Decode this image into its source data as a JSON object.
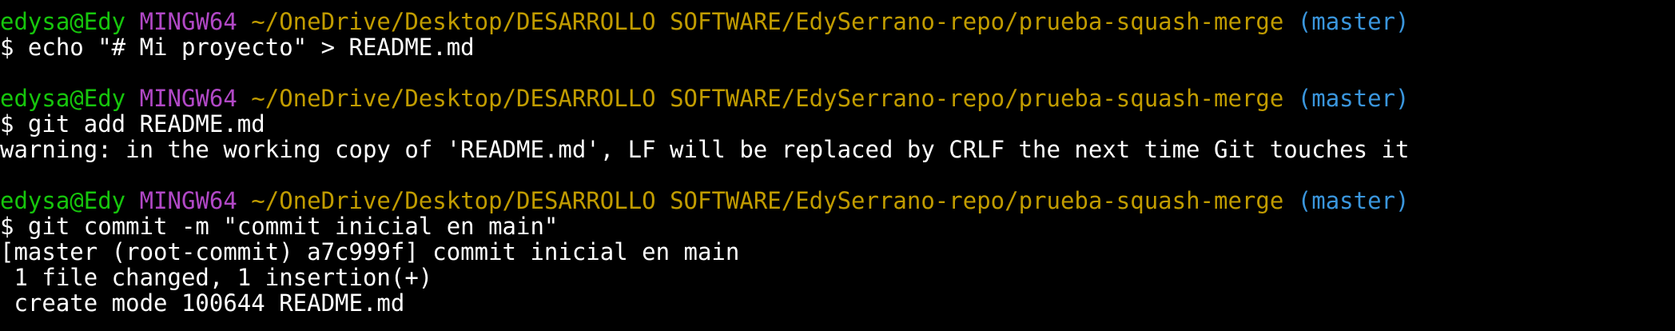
{
  "colors": {
    "background": "#000000",
    "user": "#16c60c",
    "env": "#b148c6",
    "path": "#c19c00",
    "branch": "#3a96dd",
    "text": "#ffffff"
  },
  "blocks": [
    {
      "prompt": {
        "user": "edysa@Edy",
        "env": "MINGW64",
        "path": "~/OneDrive/Desktop/DESARROLLO SOFTWARE/EdySerrano-repo/prueba-squash-merge",
        "branch": "(master)"
      },
      "command": "$ echo \"# Mi proyecto\" > README.md",
      "output": []
    },
    {
      "prompt": {
        "user": "edysa@Edy",
        "env": "MINGW64",
        "path": "~/OneDrive/Desktop/DESARROLLO SOFTWARE/EdySerrano-repo/prueba-squash-merge",
        "branch": "(master)"
      },
      "command": "$ git add README.md",
      "output": [
        "warning: in the working copy of 'README.md', LF will be replaced by CRLF the next time Git touches it"
      ]
    },
    {
      "prompt": {
        "user": "edysa@Edy",
        "env": "MINGW64",
        "path": "~/OneDrive/Desktop/DESARROLLO SOFTWARE/EdySerrano-repo/prueba-squash-merge",
        "branch": "(master)"
      },
      "command": "$ git commit -m \"commit inicial en main\"",
      "output": [
        "[master (root-commit) a7c999f] commit inicial en main",
        " 1 file changed, 1 insertion(+)",
        " create mode 100644 README.md"
      ]
    }
  ]
}
